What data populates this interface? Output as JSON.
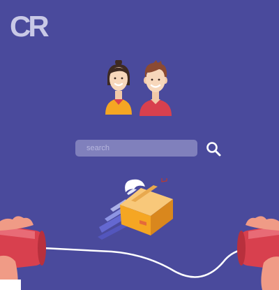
{
  "logo": {
    "text": "CR"
  },
  "search": {
    "placeholder": "search",
    "value": ""
  },
  "icons": {
    "search": "search-icon",
    "avatars": [
      "woman-avatar-icon",
      "man-avatar-icon"
    ],
    "parcel": "flying-package-icon",
    "scene": "tin-can-telephone-illustration"
  },
  "colors": {
    "background": "#4a4a9c",
    "search_field": "#8080bc",
    "accent_red": "#d8404e",
    "accent_orange": "#f5a623"
  }
}
